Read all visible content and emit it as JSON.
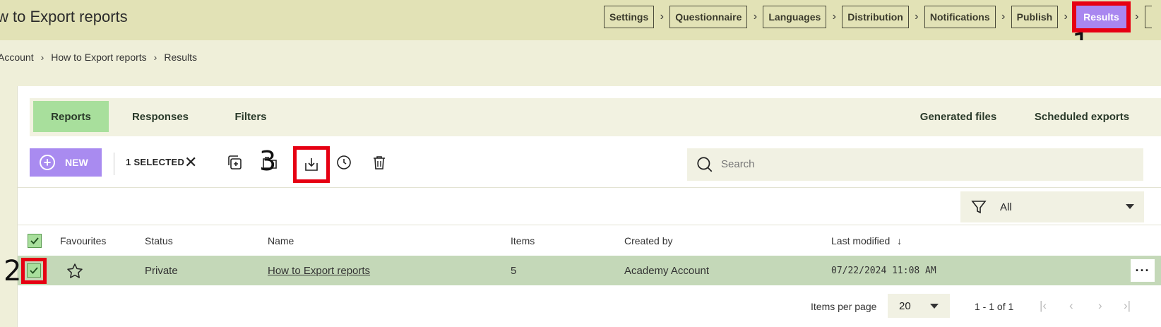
{
  "header": {
    "title": "w to Export reports",
    "steps": [
      {
        "label": "Settings",
        "active": false
      },
      {
        "label": "Questionnaire",
        "active": false
      },
      {
        "label": "Languages",
        "active": false
      },
      {
        "label": "Distribution",
        "active": false
      },
      {
        "label": "Notifications",
        "active": false
      },
      {
        "label": "Publish",
        "active": false
      },
      {
        "label": "Results",
        "active": true
      }
    ]
  },
  "breadcrumb": [
    "Account",
    "How to Export reports",
    "Results"
  ],
  "markers": {
    "m1": "1",
    "m2": "2",
    "m3": "3"
  },
  "tabs": {
    "left": [
      "Reports",
      "Responses",
      "Filters"
    ],
    "right": [
      "Generated files",
      "Scheduled exports"
    ],
    "active": "Reports"
  },
  "toolbar": {
    "new_label": "NEW",
    "selected_label": "1 SELECTED",
    "search_placeholder": "Search"
  },
  "filter": {
    "value": "All"
  },
  "table": {
    "columns": [
      "Favourites",
      "Status",
      "Name",
      "Items",
      "Created by",
      "Last modified"
    ],
    "rows": [
      {
        "status": "Private",
        "name": "How to Export reports",
        "items": "5",
        "created_by": "Academy Account",
        "last_modified": "07/22/2024 11:08 AM",
        "selected": true
      }
    ]
  },
  "pagination": {
    "items_per_page_label": "Items per page",
    "items_per_page": "20",
    "range": "1 - 1 of 1"
  },
  "colors": {
    "accent_purple": "#a98bf0",
    "active_tab_green": "#a8df9c",
    "selected_row": "#c4d8b8",
    "highlight_red": "#e60012"
  }
}
